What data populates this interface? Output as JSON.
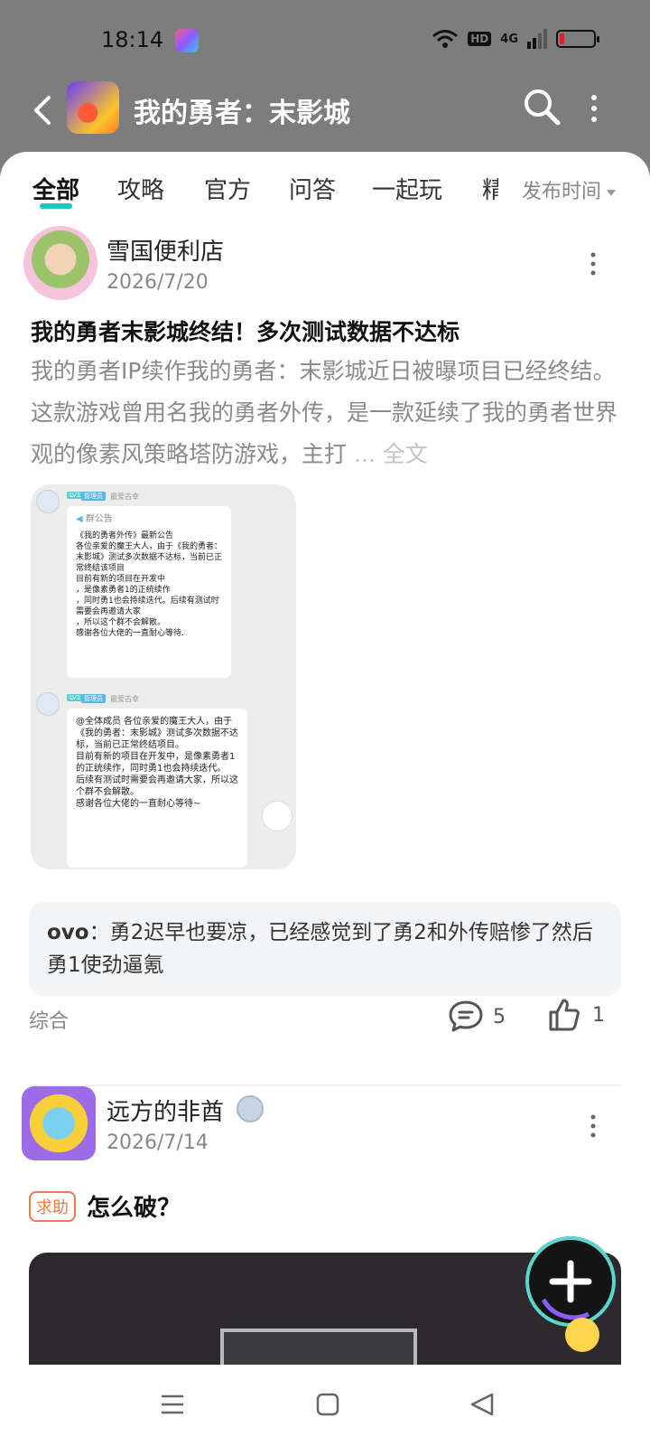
{
  "status": {
    "time": "18:14",
    "hd": "HD",
    "network": "4G"
  },
  "header": {
    "title": "我的勇者：末影城"
  },
  "tabs": {
    "items": [
      {
        "label": "全部",
        "active": true
      },
      {
        "label": "攻略"
      },
      {
        "label": "官方"
      },
      {
        "label": "问答"
      },
      {
        "label": "一起玩"
      },
      {
        "label": "精"
      }
    ],
    "sort_label": "发布时间"
  },
  "post1": {
    "author": "雪国便利店",
    "date": "2026/7/20",
    "title": "我的勇者末影城终结！多次测试数据不达标",
    "excerpt": "我的勇者IP续作我的勇者：末影城近日被曝项目已经终结。这款游戏曾用名我的勇者外传，是一款延续了我的勇者世界观的像素风策略塔防游戏，主打",
    "ellipsis": "...",
    "full_label": "全文",
    "image": {
      "role": "管理员",
      "level": "LV1",
      "username": "最爱古幸",
      "notice_label": "群公告",
      "notice": "《我的勇者外传》最新公告\n各位亲爱的魔王大人，由于《我的勇者：末影城》测试多次数据不达标，当前已正常终结该项目\n目前有新的项目在开发中\n，是像素勇者1的正统续作\n，同时勇1也会持续迭代。后续有测试时需要会再邀请大家\n，所以这个群不会解散。\n感谢各位大佬的一直耐心等待.",
      "message": "@全体成员 各位亲爱的魔王大人，由于《我的勇者：末影城》测试多次数据不达标，当前已正常终结项目。\n目前有新的项目在开发中，是像素勇者1的正统续作，同时勇1也会持续迭代。\n后续有测试时需要会再邀请大家，所以这个群不会解散。\n感谢各位大佬的一直耐心等待~"
    },
    "comment": {
      "user": "ovo",
      "text": "勇2迟早也要凉，已经感觉到了勇2和外传赔惨了然后勇1使劲逼氪"
    },
    "category": "综合",
    "comments_count": "5",
    "likes_count": "1"
  },
  "post2": {
    "author": "远方的非酋",
    "date": "2026/7/14",
    "tag": "求助",
    "title": "怎么破？"
  },
  "colors": {
    "accent": "#1bc6c6",
    "tag": "#ef7a4a",
    "header_bg": "#7d7d7d"
  }
}
